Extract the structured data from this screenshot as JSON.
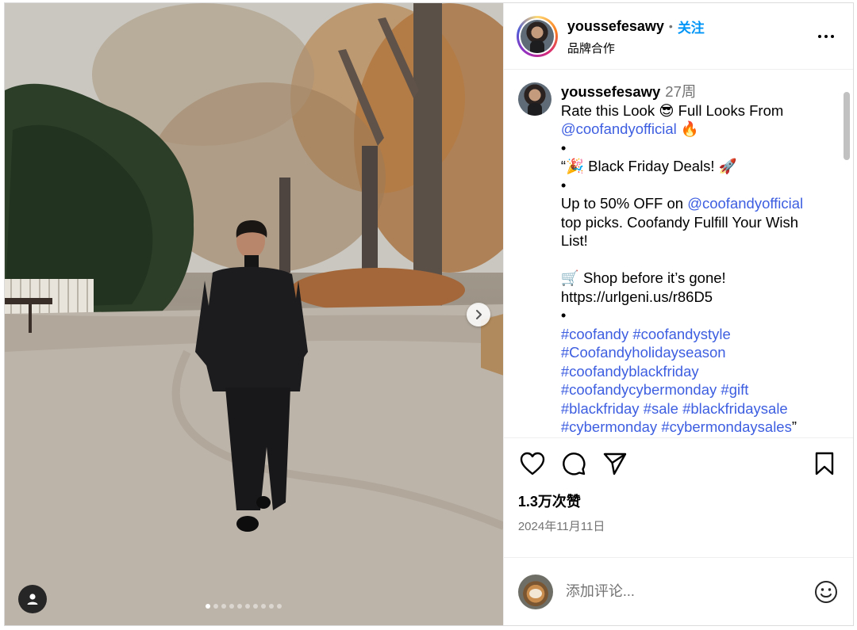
{
  "post": {
    "username": "youssefesawy",
    "follow_label": "关注",
    "separator": "•",
    "subtitle": "品牌合作",
    "time": "27周"
  },
  "caption": {
    "lines": [
      {
        "parts": [
          {
            "t": "Rate this Look 😎 Full Looks From"
          }
        ]
      },
      {
        "parts": [
          {
            "t": "@coofandyofficial",
            "m": true
          },
          {
            "t": " 🔥"
          }
        ]
      },
      {
        "parts": [
          {
            "t": "•"
          }
        ]
      },
      {
        "parts": [
          {
            "t": "“🎉 Black Friday Deals! 🚀"
          }
        ]
      },
      {
        "parts": [
          {
            "t": "•"
          }
        ]
      },
      {
        "parts": [
          {
            "t": "Up to 50% OFF on "
          },
          {
            "t": "@coofandyofficial",
            "m": true
          }
        ]
      },
      {
        "parts": [
          {
            "t": "top picks. Coofandy Fulfill Your Wish"
          }
        ]
      },
      {
        "parts": [
          {
            "t": "List!"
          }
        ]
      },
      {
        "parts": [
          {
            "t": ""
          }
        ]
      },
      {
        "parts": [
          {
            "t": "🛒 Shop before it’s gone!"
          }
        ]
      },
      {
        "parts": [
          {
            "t": "https://urlgeni.us/r86D5"
          }
        ]
      },
      {
        "parts": [
          {
            "t": "•"
          }
        ]
      },
      {
        "parts": [
          {
            "t": "#coofandy",
            "m": true
          },
          {
            "t": " "
          },
          {
            "t": "#coofandystyle",
            "m": true
          }
        ]
      },
      {
        "parts": [
          {
            "t": "#Coofandyholidayseason",
            "m": true
          }
        ]
      },
      {
        "parts": [
          {
            "t": "#coofandyblackfriday",
            "m": true
          }
        ]
      },
      {
        "parts": [
          {
            "t": "#coofandycybermonday",
            "m": true
          },
          {
            "t": " "
          },
          {
            "t": "#gift",
            "m": true
          }
        ]
      },
      {
        "parts": [
          {
            "t": "#blackfriday",
            "m": true
          },
          {
            "t": " "
          },
          {
            "t": "#sale",
            "m": true
          },
          {
            "t": " "
          },
          {
            "t": "#blackfridaysale",
            "m": true
          }
        ]
      },
      {
        "parts": [
          {
            "t": "#cybermonday",
            "m": true
          },
          {
            "t": " "
          },
          {
            "t": "#cybermondaysales",
            "m": true
          },
          {
            "t": "”"
          }
        ]
      }
    ]
  },
  "stats": {
    "likes": "1.3万次赞",
    "date": "2024年11月11日"
  },
  "comment_box": {
    "placeholder": "添加评论..."
  },
  "carousel": {
    "slide_count": 10,
    "active_index": 0
  },
  "icons": {
    "like": "heart-icon",
    "comment": "comment-bubble-icon",
    "share": "paper-plane-icon",
    "save": "bookmark-icon",
    "more": "more-horizontal-icon",
    "next": "chevron-right-icon",
    "tags": "user-tag-icon",
    "emoji": "emoji-smile-icon"
  },
  "colors": {
    "link": "#3d5ee0",
    "follow": "#0095f6",
    "muted": "#737373"
  }
}
